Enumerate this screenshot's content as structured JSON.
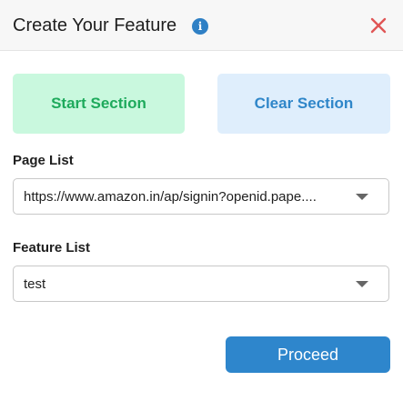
{
  "header": {
    "title": "Create Your Feature",
    "info_icon": "info-icon",
    "close_icon": "close-icon",
    "info_glyph": "i"
  },
  "sections": {
    "start_label": "Start Section",
    "clear_label": "Clear Section"
  },
  "page_list": {
    "label": "Page List",
    "selected": "https://www.amazon.in/ap/signin?openid.pape...."
  },
  "feature_list": {
    "label": "Feature List",
    "selected": "test"
  },
  "actions": {
    "proceed_label": "Proceed"
  },
  "colors": {
    "start_bg": "#c9f8de",
    "start_text": "#1eaa5c",
    "clear_bg": "#dfeefc",
    "clear_text": "#2f86c9",
    "primary": "#2e86cc",
    "close": "#e05555"
  }
}
